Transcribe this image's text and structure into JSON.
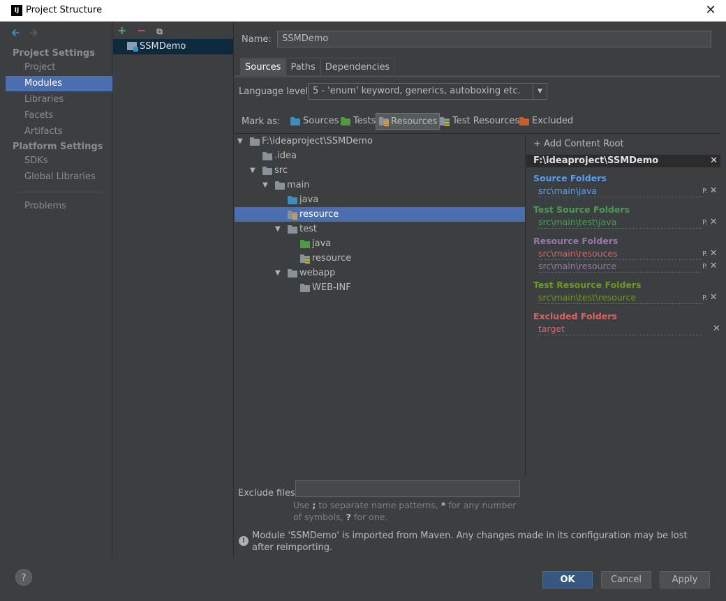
{
  "window": {
    "title": "Project Structure",
    "app_icon_label": "IJ",
    "close_glyph": "✕"
  },
  "nav": {
    "back_glyph": "🡰",
    "forward_glyph": "🡲",
    "sections": [
      {
        "title": "Project Settings",
        "items": [
          "Project",
          "Modules",
          "Libraries",
          "Facets",
          "Artifacts"
        ]
      },
      {
        "title": "Platform Settings",
        "items": [
          "SDKs",
          "Global Libraries"
        ]
      }
    ],
    "extra_items": [
      "Problems"
    ],
    "selected": "Modules"
  },
  "modules": {
    "toolbar": {
      "add": "+",
      "remove": "−",
      "copy": "⧉"
    },
    "items": [
      "SSMDemo"
    ]
  },
  "main": {
    "name_label": "Name:",
    "name_value": "SSMDemo",
    "tabs": [
      "Sources",
      "Paths",
      "Dependencies"
    ],
    "active_tab": "Sources",
    "language_label": "Language level:",
    "language_value": "5 - 'enum' keyword, generics, autoboxing etc.",
    "mark_as_label": "Mark as:",
    "mark_buttons": [
      "Sources",
      "Tests",
      "Resources",
      "Test Resources",
      "Excluded"
    ],
    "pressed_mark": "Resources",
    "tree": [
      {
        "label": "F:\\ideaproject\\SSMDemo",
        "depth": 0,
        "expanded": true,
        "icon": "grey"
      },
      {
        "label": ".idea",
        "depth": 1,
        "expanded": null,
        "icon": "grey"
      },
      {
        "label": "src",
        "depth": 1,
        "expanded": true,
        "icon": "grey"
      },
      {
        "label": "main",
        "depth": 2,
        "expanded": true,
        "icon": "grey"
      },
      {
        "label": "java",
        "depth": 3,
        "expanded": null,
        "icon": "blue"
      },
      {
        "label": "resource",
        "depth": 3,
        "expanded": null,
        "icon": "res",
        "selected": true
      },
      {
        "label": "test",
        "depth": 3,
        "expanded": true,
        "icon": "grey"
      },
      {
        "label": "java",
        "depth": 4,
        "expanded": null,
        "icon": "green"
      },
      {
        "label": "resource",
        "depth": 4,
        "expanded": null,
        "icon": "tres"
      },
      {
        "label": "webapp",
        "depth": 3,
        "expanded": true,
        "icon": "grey"
      },
      {
        "label": "WEB-INF",
        "depth": 4,
        "expanded": null,
        "icon": "grey"
      }
    ],
    "add_content_root": "+ Add Content Root",
    "content_root": "F:\\ideaproject\\SSMDemo",
    "folder_groups": [
      {
        "title": "Source Folders",
        "color": "#589df6",
        "paths": [
          "src\\main\\java"
        ]
      },
      {
        "title": "Test Source Folders",
        "color": "#499c54",
        "paths": [
          "src\\main\\test\\java"
        ]
      },
      {
        "title": "Resource Folders",
        "color": "#9876aa",
        "paths": [
          "src\\main\\resouces",
          "src\\main\\resource"
        ]
      },
      {
        "title": "Test Resource Folders",
        "color": "#6d9a1a",
        "paths": [
          "src\\main\\test\\resource"
        ]
      },
      {
        "title": "Excluded Folders",
        "color": "#e06060",
        "paths": [
          "target"
        ]
      }
    ],
    "path_props_glyph": "P.",
    "path_remove_glyph": "✕",
    "exclude_label": "Exclude files:",
    "exclude_value": "",
    "hint_pre": "Use",
    "hint_sep": ";",
    "hint_mid": "to separate name patterns,",
    "hint_star": "*",
    "hint_mid2": "for any number of symbols,",
    "hint_q": "?",
    "hint_end": "for one.",
    "warning": "Module 'SSMDemo' is imported from Maven. Any changes made in its configuration may be lost after reimporting."
  },
  "footer": {
    "help": "?",
    "ok": "OK",
    "cancel": "Cancel",
    "apply": "Apply"
  }
}
